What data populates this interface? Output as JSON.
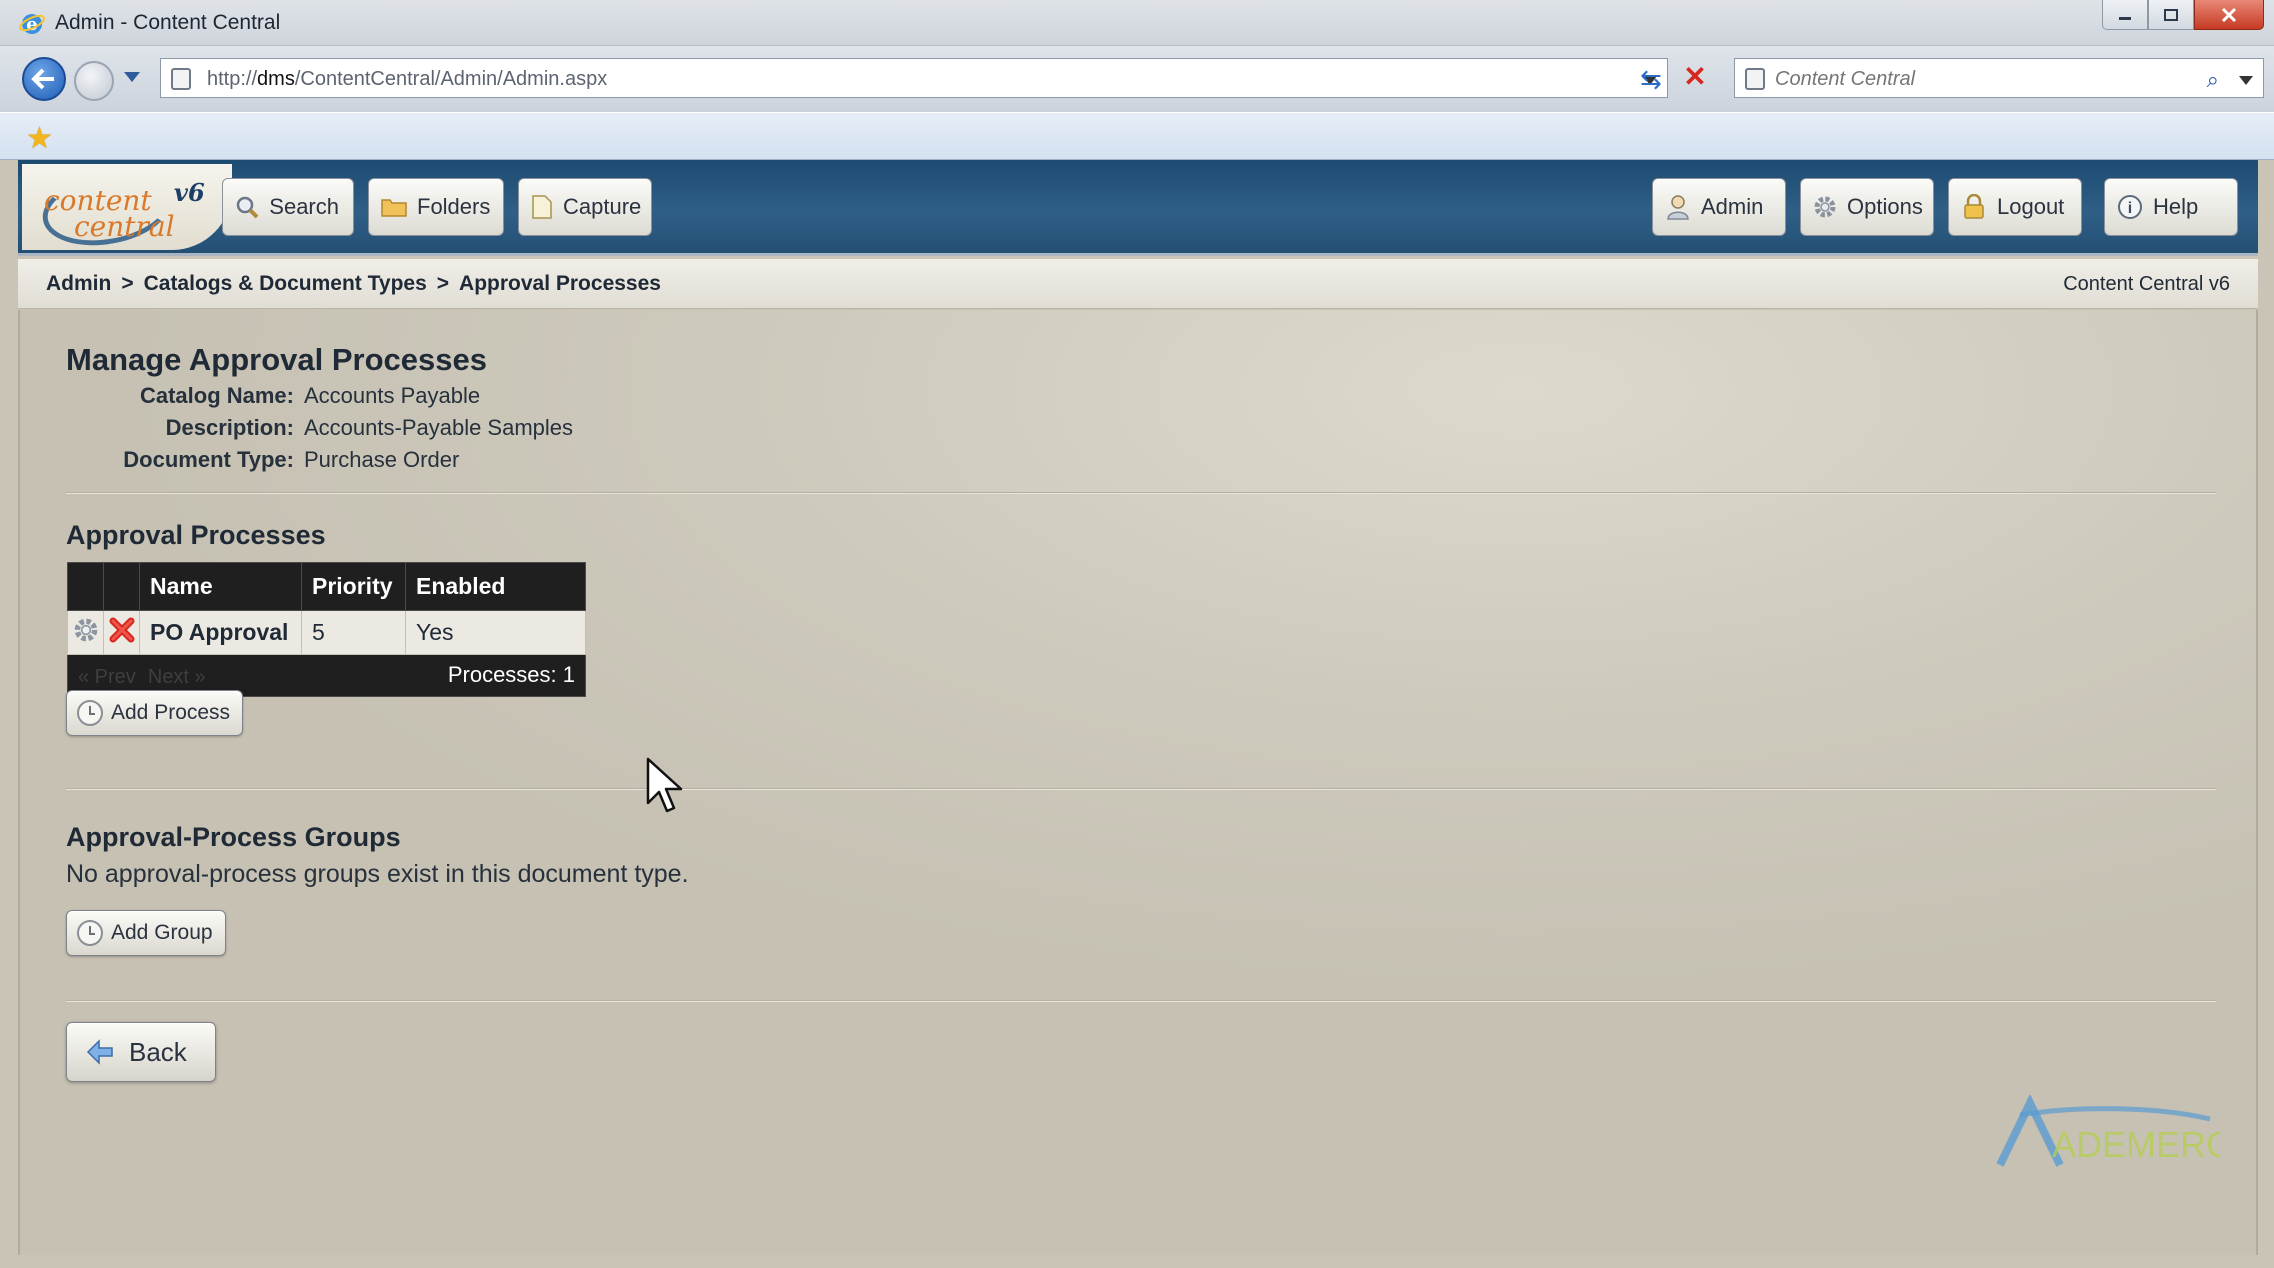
{
  "window": {
    "title": "Admin - Content Central"
  },
  "browser": {
    "url_prefix": "http://",
    "url_host": "dms",
    "url_path": "/ContentCentral/Admin/Admin.aspx",
    "search_placeholder": "Content Central"
  },
  "header": {
    "logo_line1": "content",
    "logo_line2": "central",
    "logo_version": "v6",
    "nav_left": [
      {
        "label": "Search",
        "icon": "search-icon"
      },
      {
        "label": "Folders",
        "icon": "folder-icon"
      },
      {
        "label": "Capture",
        "icon": "capture-icon"
      }
    ],
    "nav_right": [
      {
        "label": "Admin",
        "icon": "admin-user-icon"
      },
      {
        "label": "Options",
        "icon": "gear-icon"
      },
      {
        "label": "Logout",
        "icon": "lock-icon"
      },
      {
        "label": "Help",
        "icon": "help-icon"
      }
    ]
  },
  "breadcrumb": {
    "items": [
      "Admin",
      "Catalogs & Document Types",
      "Approval Processes"
    ],
    "separator": ">",
    "version": "Content Central v6"
  },
  "page": {
    "title": "Manage Approval Processes",
    "meta": [
      {
        "label": "Catalog Name:",
        "value": "Accounts Payable"
      },
      {
        "label": "Description:",
        "value": "Accounts-Payable Samples"
      },
      {
        "label": "Document Type:",
        "value": "Purchase Order"
      }
    ]
  },
  "processes": {
    "heading": "Approval Processes",
    "columns": [
      "Name",
      "Priority",
      "Enabled"
    ],
    "rows": [
      {
        "name": "PO Approval",
        "priority": "5",
        "enabled": "Yes"
      }
    ],
    "pager_prev": "« Prev",
    "pager_next": "Next »",
    "count_label": "Processes: 1",
    "add_button": "Add Process"
  },
  "groups": {
    "heading": "Approval-Process Groups",
    "empty_message": "No approval-process groups exist in this document type.",
    "add_button": "Add Group"
  },
  "footer": {
    "back_button": "Back",
    "brand_logo": "ADEMERO"
  },
  "colors": {
    "header_blue": "#2f5f86",
    "content_bg": "#cdc9bc",
    "table_header": "#1f1f1f",
    "delete_red": "#d6281f"
  }
}
